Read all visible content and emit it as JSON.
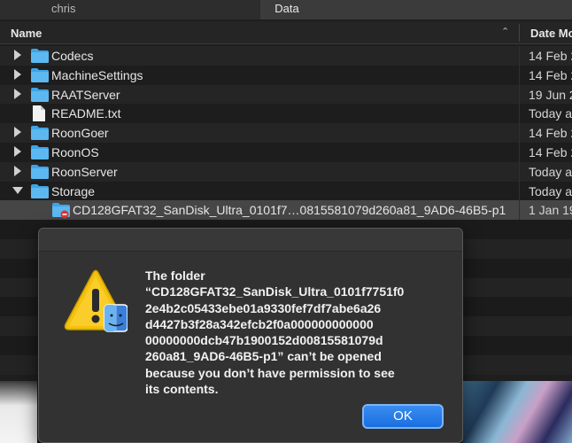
{
  "tabs": [
    {
      "label": "chris"
    },
    {
      "label": "Data"
    }
  ],
  "columns": {
    "name": "Name",
    "date": "Date Mo"
  },
  "rows": [
    {
      "label": "Codecs",
      "date": "14 Feb 2",
      "type": "folder",
      "expanded": false
    },
    {
      "label": "MachineSettings",
      "date": "14 Feb 2",
      "type": "folder",
      "expanded": false
    },
    {
      "label": "RAATServer",
      "date": "19 Jun 2",
      "type": "folder",
      "expanded": false
    },
    {
      "label": "README.txt",
      "date": "Today a",
      "type": "file"
    },
    {
      "label": "RoonGoer",
      "date": "14 Feb 2",
      "type": "folder",
      "expanded": false
    },
    {
      "label": "RoonOS",
      "date": "14 Feb 2",
      "type": "folder",
      "expanded": false
    },
    {
      "label": "RoonServer",
      "date": "Today a",
      "type": "folder",
      "expanded": false
    },
    {
      "label": "Storage",
      "date": "Today a",
      "type": "folder",
      "expanded": true
    },
    {
      "label": "CD128GFAT32_SanDisk_Ultra_0101f7…0815581079d260a81_9AD6-46B5-p1",
      "date": "1 Jan 19",
      "type": "restricted-folder"
    }
  ],
  "dialog": {
    "message_lines": [
      "The folder",
      "“CD128GFAT32_SanDisk_Ultra_0101f7751f0",
      "2e4b2c05433ebe01a9330fef7df7abe6a26",
      "d4427b3f28a342efcb2f0a000000000000",
      "00000000dcb47b1900152d00815581079d",
      "260a81_9AD6-46B5-p1” can’t be opened",
      "because you don’t have permission to see",
      "its contents."
    ],
    "ok_label": "OK"
  },
  "colors": {
    "accent": "#1a6fe0",
    "folder": "#3ea4e6",
    "warning": "#f4c20d"
  }
}
